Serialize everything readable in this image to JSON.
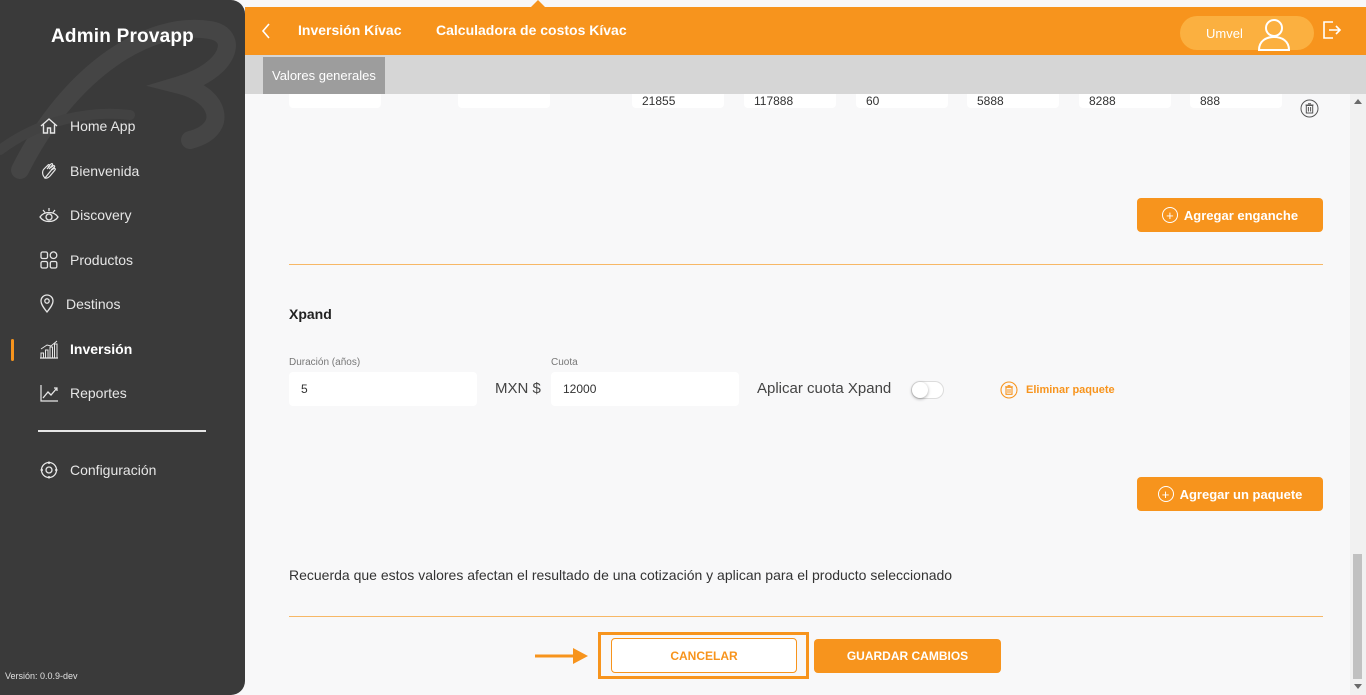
{
  "sidebar": {
    "brand": "Admin Provapp",
    "items": [
      {
        "label": "Home App",
        "icon": "home-icon"
      },
      {
        "label": "Bienvenida",
        "icon": "waving-hand-icon"
      },
      {
        "label": "Discovery",
        "icon": "eye-icon"
      },
      {
        "label": "Productos",
        "icon": "grid-icon"
      },
      {
        "label": "Destinos",
        "icon": "location-pin-icon"
      },
      {
        "label": "Inversión",
        "icon": "bar-chart-icon",
        "active": true
      },
      {
        "label": "Reportes",
        "icon": "line-chart-icon"
      }
    ],
    "settings_label": "Configuración",
    "version": "Versión: 0.0.9-dev"
  },
  "header": {
    "crumb_1": "Inversión Kívac",
    "crumb_2": "Calculadora de costos Kívac",
    "user_name": "Umvel"
  },
  "tabs": [
    "Valores generales"
  ],
  "prev_row": {
    "left_values": [
      "",
      ""
    ],
    "values": [
      "21855",
      "117888",
      "60",
      "5888",
      "8288",
      "888"
    ]
  },
  "buttons": {
    "add_downpayment": "Agregar enganche",
    "add_package": "Agregar un paquete",
    "cancel": "CANCELAR",
    "save": "GUARDAR CAMBIOS"
  },
  "xpand": {
    "title": "Xpand",
    "duration_label": "Duración (años)",
    "duration_value": "5",
    "currency": "MXN $",
    "fee_label": "Cuota",
    "fee_value": "12000",
    "apply_label": "Aplicar cuota Xpand",
    "apply_enabled": false,
    "delete_label": "Eliminar paquete"
  },
  "reminder": "Recuerda que estos valores afectan el resultado de una cotización y aplican para el producto seleccionado",
  "colors": {
    "accent": "#f7941d",
    "sidebar_bg": "#3a3a3a",
    "content_bg": "#f8f8f9"
  }
}
